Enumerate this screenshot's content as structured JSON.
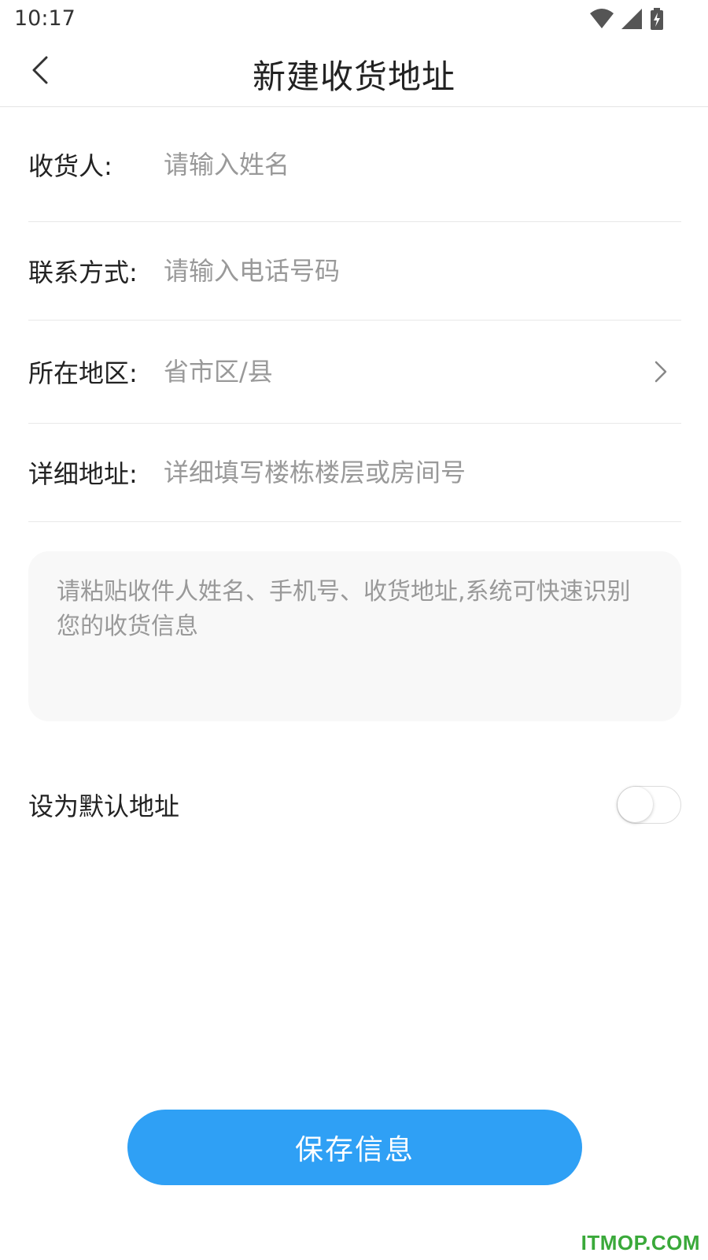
{
  "status_bar": {
    "time": "10:17",
    "icons": [
      "wifi-icon",
      "signal-icon",
      "battery-charging-icon"
    ]
  },
  "header": {
    "title": "新建收货地址",
    "back_icon": "chevron-left-icon"
  },
  "form": {
    "name": {
      "label": "收货人:",
      "placeholder": "请输入姓名",
      "value": ""
    },
    "phone": {
      "label": "联系方式:",
      "placeholder": "请输入电话号码",
      "value": ""
    },
    "region": {
      "label": "所在地区:",
      "placeholder": "省市区/县",
      "icon": "chevron-right-icon"
    },
    "detail": {
      "label": "详细地址:",
      "placeholder": "详细填写楼栋楼层或房间号",
      "value": ""
    },
    "paste": {
      "placeholder": "请粘贴收件人姓名、手机号、收货地址,系统可快速识别您的收货信息",
      "value": ""
    },
    "default_address": {
      "label": "设为默认地址",
      "enabled": false
    }
  },
  "actions": {
    "save_label": "保存信息"
  },
  "watermark": "ITMOP.COM",
  "colors": {
    "accent": "#2fa0f5",
    "placeholder": "#999999",
    "divider": "#e8e8e8",
    "watermark": "#3aa93a"
  }
}
